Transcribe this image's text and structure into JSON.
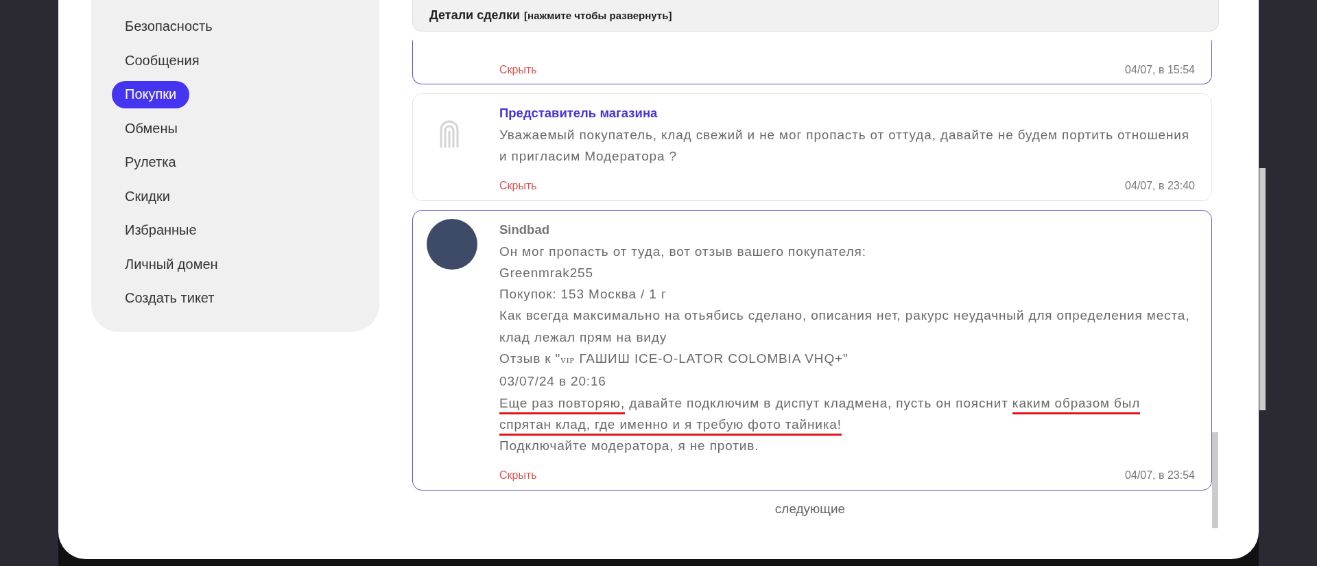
{
  "sidebar": {
    "items": [
      {
        "label": "Безопасность",
        "selected": false
      },
      {
        "label": "Сообщения",
        "selected": false
      },
      {
        "label": "Покупки",
        "selected": true
      },
      {
        "label": "Обмены",
        "selected": false
      },
      {
        "label": "Рулетка",
        "selected": false
      },
      {
        "label": "Скидки",
        "selected": false
      },
      {
        "label": "Избранные",
        "selected": false
      },
      {
        "label": "Личный домен",
        "selected": false
      },
      {
        "label": "Создать тикет",
        "selected": false
      }
    ]
  },
  "deal_details": {
    "title": "Детали сделки",
    "hint": "[нажмите чтобы развернуть]"
  },
  "messages": [
    {
      "kind": "clipped",
      "hide": "Скрыть",
      "date": "04/07, в 15:54",
      "highlighted": true
    },
    {
      "kind": "store",
      "author": "Представитель магазина",
      "highlighted": false,
      "paragraphs": [
        {
          "kind": "plain",
          "text": "Уважаемый покупатель, клад свежий и не мог пропасть от оттуда, давайте не будем портить отношения и пригласим Модератора ?"
        }
      ],
      "hide": "Скрыть",
      "date": "04/07, в 23:40"
    },
    {
      "kind": "user",
      "author": "Sindbad",
      "highlighted": true,
      "paragraphs": [
        {
          "kind": "plain",
          "text": "Он мог пропасть от туда, вот отзыв вашего покупателя:"
        },
        {
          "kind": "plain",
          "text": "Greenmrak255"
        },
        {
          "kind": "plain",
          "text": "Покупок: 153 Москва / 1 г"
        },
        {
          "kind": "plain",
          "text": "Как всегда максимально на отьябись сделано, описания нет, ракурс неудачный для определения места, клад лежал прям на виду"
        },
        {
          "kind": "quote",
          "prefix": "Отзыв к \"",
          "tag": "ᴠɪᴘ",
          "rest": " ГАШИШ ICE-O-LATOR COLOMBIA VHQ+\""
        },
        {
          "kind": "plain",
          "text": "03/07/24 в 20:16"
        },
        {
          "kind": "marked",
          "segments": [
            {
              "text": "Еще раз повторяю,",
              "underlined": true
            },
            {
              "text": " давайте подключим в диспут кладмена, пусть он пояснит ",
              "underlined": false
            },
            {
              "text": "каким образом был спрятан клад, где именно и я требую фото тайника!",
              "underlined": true
            }
          ]
        },
        {
          "kind": "plain",
          "text": "Подключайте модератора, я не против."
        }
      ],
      "hide": "Скрыть",
      "date": "04/07, в 23:54"
    }
  ],
  "pager": {
    "next": "следующие"
  }
}
